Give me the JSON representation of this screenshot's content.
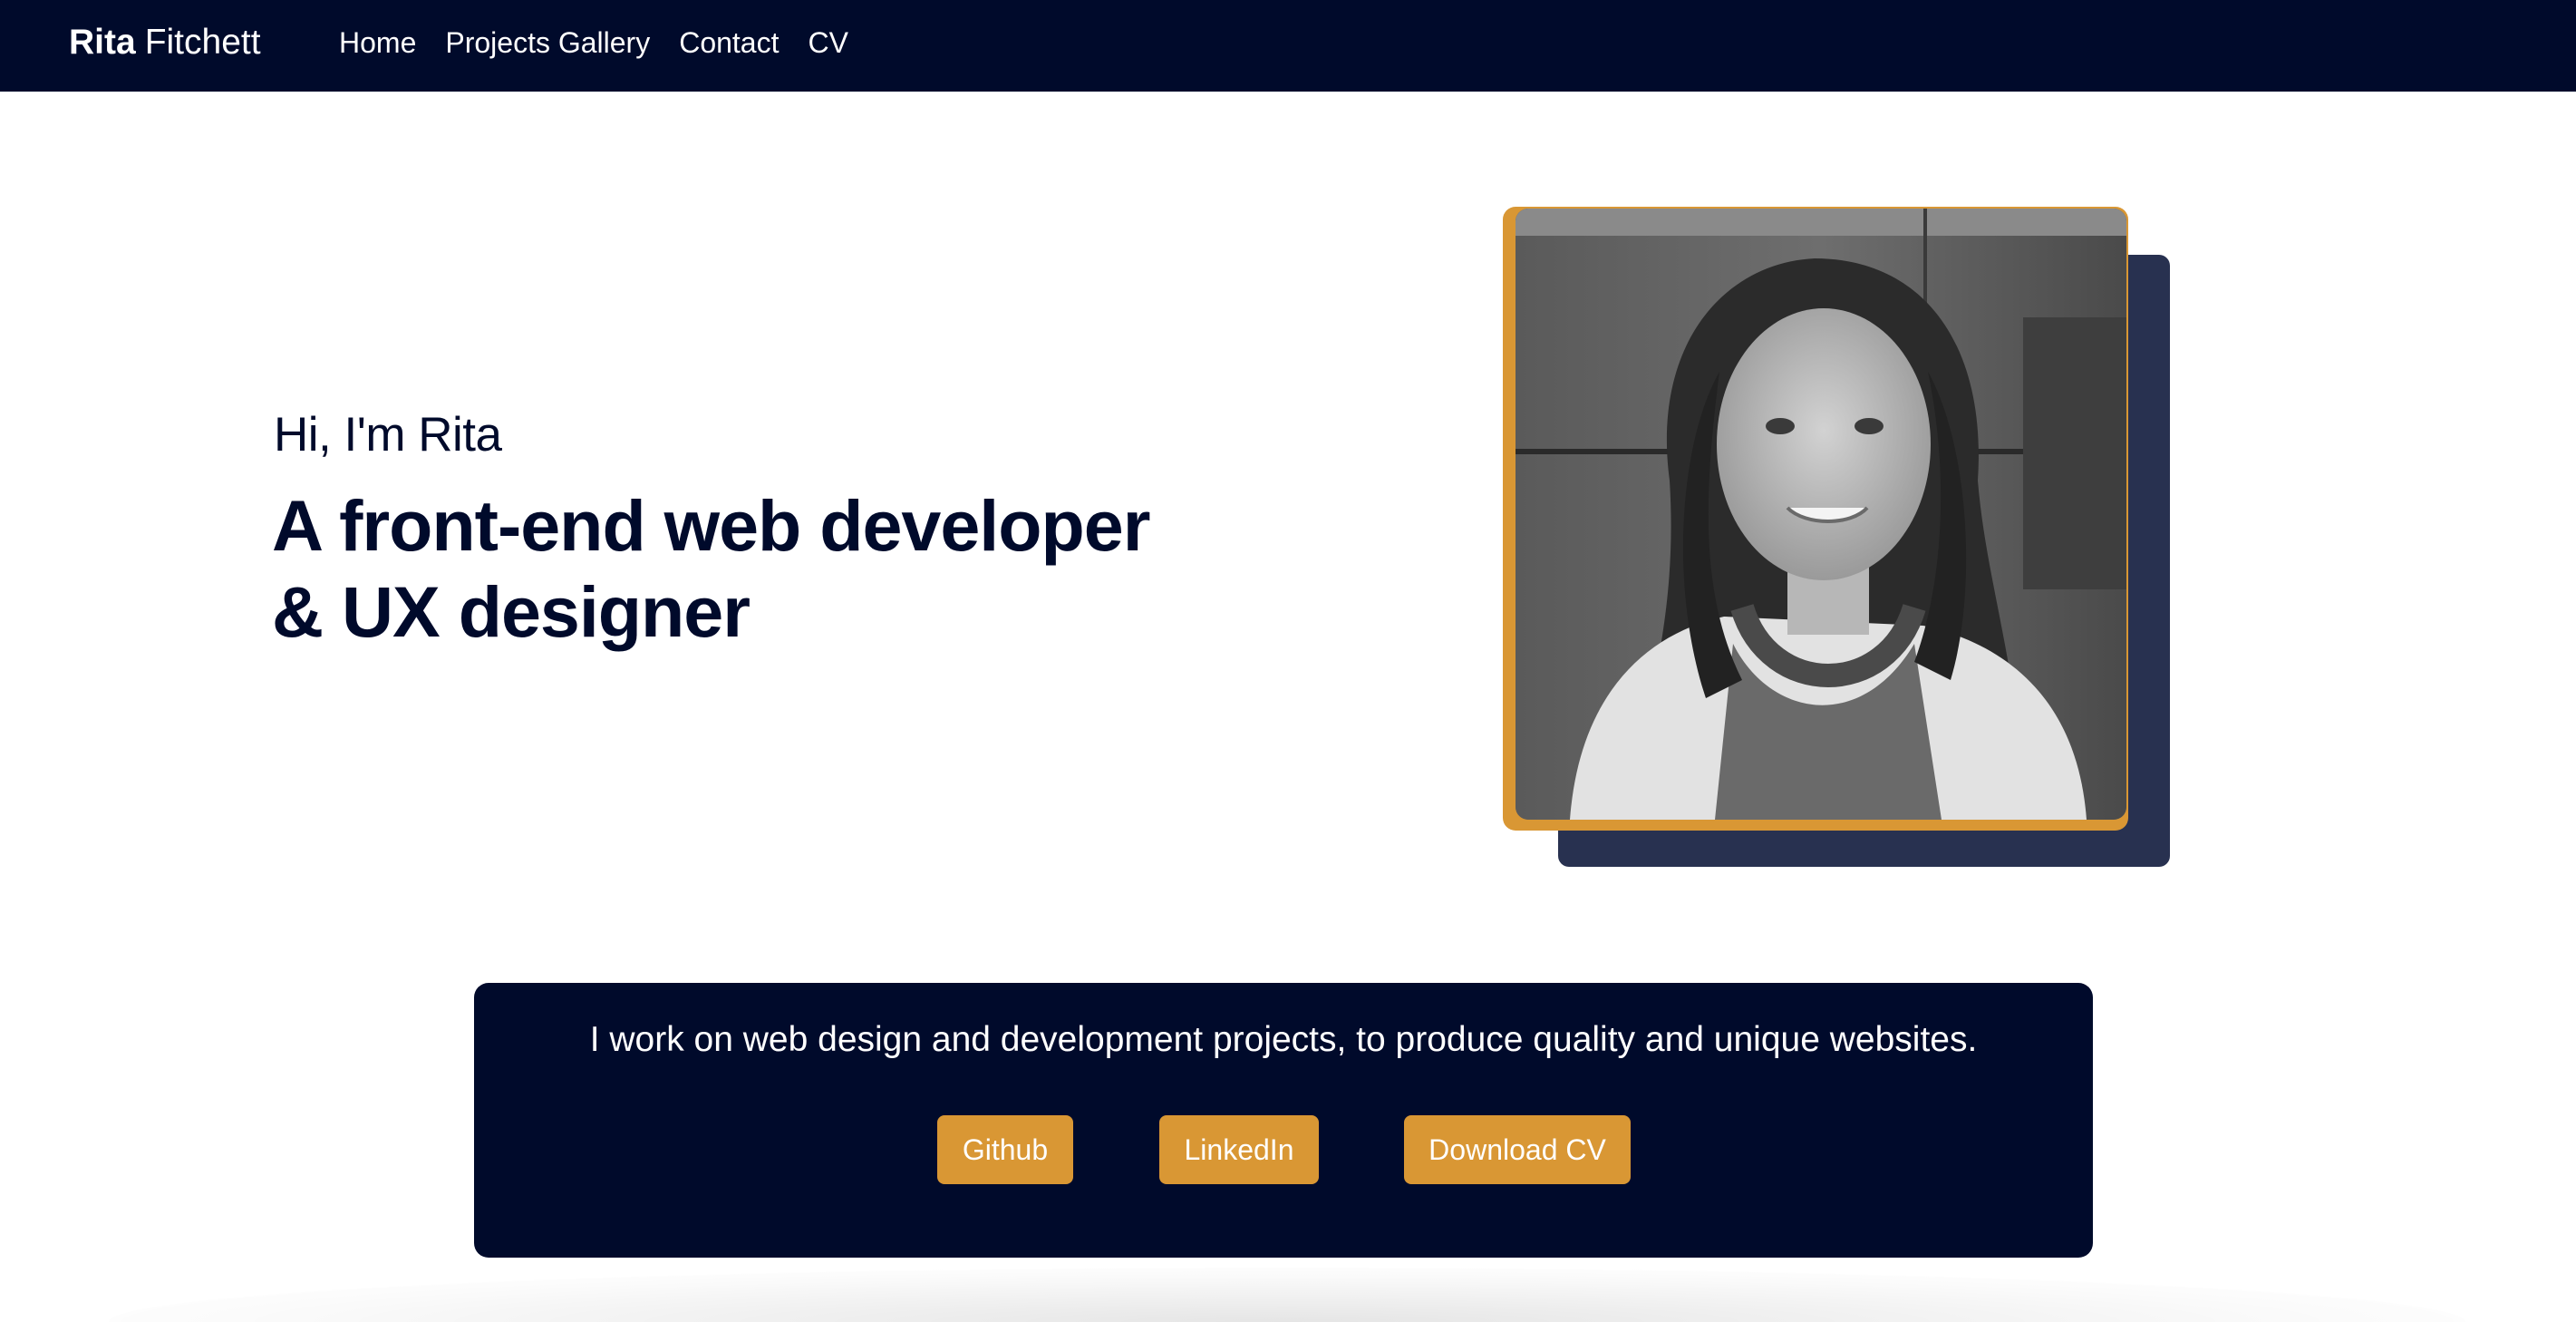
{
  "nav": {
    "brand_first": "Rita",
    "brand_last": "Fitchett",
    "links": [
      "Home",
      "Projects Gallery",
      "Contact",
      "CV"
    ]
  },
  "hero": {
    "greeting": "Hi, I'm Rita",
    "headline_line1": "A front-end web developer",
    "headline_line2": "& UX designer"
  },
  "info": {
    "text": "I work on web design and development projects, to produce quality and unique websites.",
    "buttons": {
      "github": "Github",
      "linkedin": "LinkedIn",
      "cv": "Download CV"
    }
  },
  "colors": {
    "navy": "#000a2b",
    "accent": "#d99734",
    "shadow_block": "#283150"
  }
}
